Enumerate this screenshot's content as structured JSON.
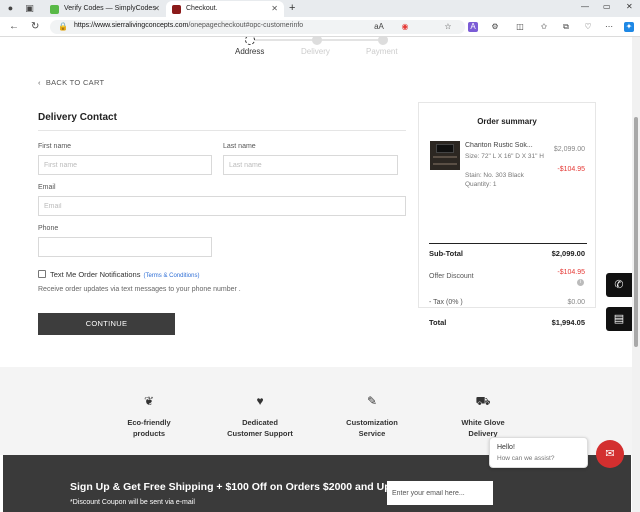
{
  "browser": {
    "tabs": [
      {
        "title": "Verify Codes — SimplyCodes",
        "fav_color": "#59b947"
      },
      {
        "title": "Checkout.",
        "fav_color": "#8b1a1a"
      }
    ],
    "new_tab_glyph": "+",
    "url_host": "https://www.sierralivingconcepts.com",
    "url_path": "/onepagecheckout#opc-customerinfo",
    "reader_label": "aA",
    "ext_badge": "16"
  },
  "checkout": {
    "steps": [
      {
        "label": "Address",
        "active": true
      },
      {
        "label": "Delivery",
        "active": false
      },
      {
        "label": "Payment",
        "active": false
      }
    ],
    "back_label": "BACK TO CART",
    "section_title": "Delivery Contact",
    "fields": {
      "first_name": {
        "label": "First name",
        "placeholder": "First name"
      },
      "last_name": {
        "label": "Last name",
        "placeholder": "Last name"
      },
      "email": {
        "label": "Email",
        "placeholder": "Email"
      },
      "phone": {
        "label": "Phone",
        "placeholder": ""
      }
    },
    "sms_label": "Text Me Order Notifications",
    "sms_link": "(Terms & Conditions)",
    "sms_help": "Receive order updates via text messages to your phone number .",
    "continue_label": "CONTINUE"
  },
  "summary": {
    "title": "Order summary",
    "product": {
      "name": "Chariton Rustic Sok...",
      "size": "Size: 72\" L X 16\" D X 31\" H",
      "stain": "Stain: No. 303 Black",
      "quantity": "Quantity: 1",
      "price": "$2,099.00",
      "discount": "-$104.95"
    },
    "subtotal_label": "Sub-Total",
    "subtotal": "$2,099.00",
    "offer_label": "Offer Discount",
    "offer": "-$104.95",
    "tax_label": "- Tax (0% )",
    "tax": "$0.00",
    "total_label": "Total",
    "total": "$1,994.05"
  },
  "features": [
    {
      "icon": "leaf-icon",
      "text": "Eco-friendly\nproducts"
    },
    {
      "icon": "support-hand-icon",
      "text": "Dedicated\nCustomer Support"
    },
    {
      "icon": "pencil-icon",
      "text": "Customization\nService"
    },
    {
      "icon": "truck-icon",
      "text": "White Glove\nDelivery"
    }
  ],
  "newsletter": {
    "title": "Sign Up & Get Free Shipping + $100 Off on Orders $2000 and Up",
    "note": "*Discount Coupon will be sent via e-mail",
    "email_placeholder": "Enter your email here..."
  },
  "chat": {
    "hello": "Hello!",
    "help": "How can we assist?"
  }
}
